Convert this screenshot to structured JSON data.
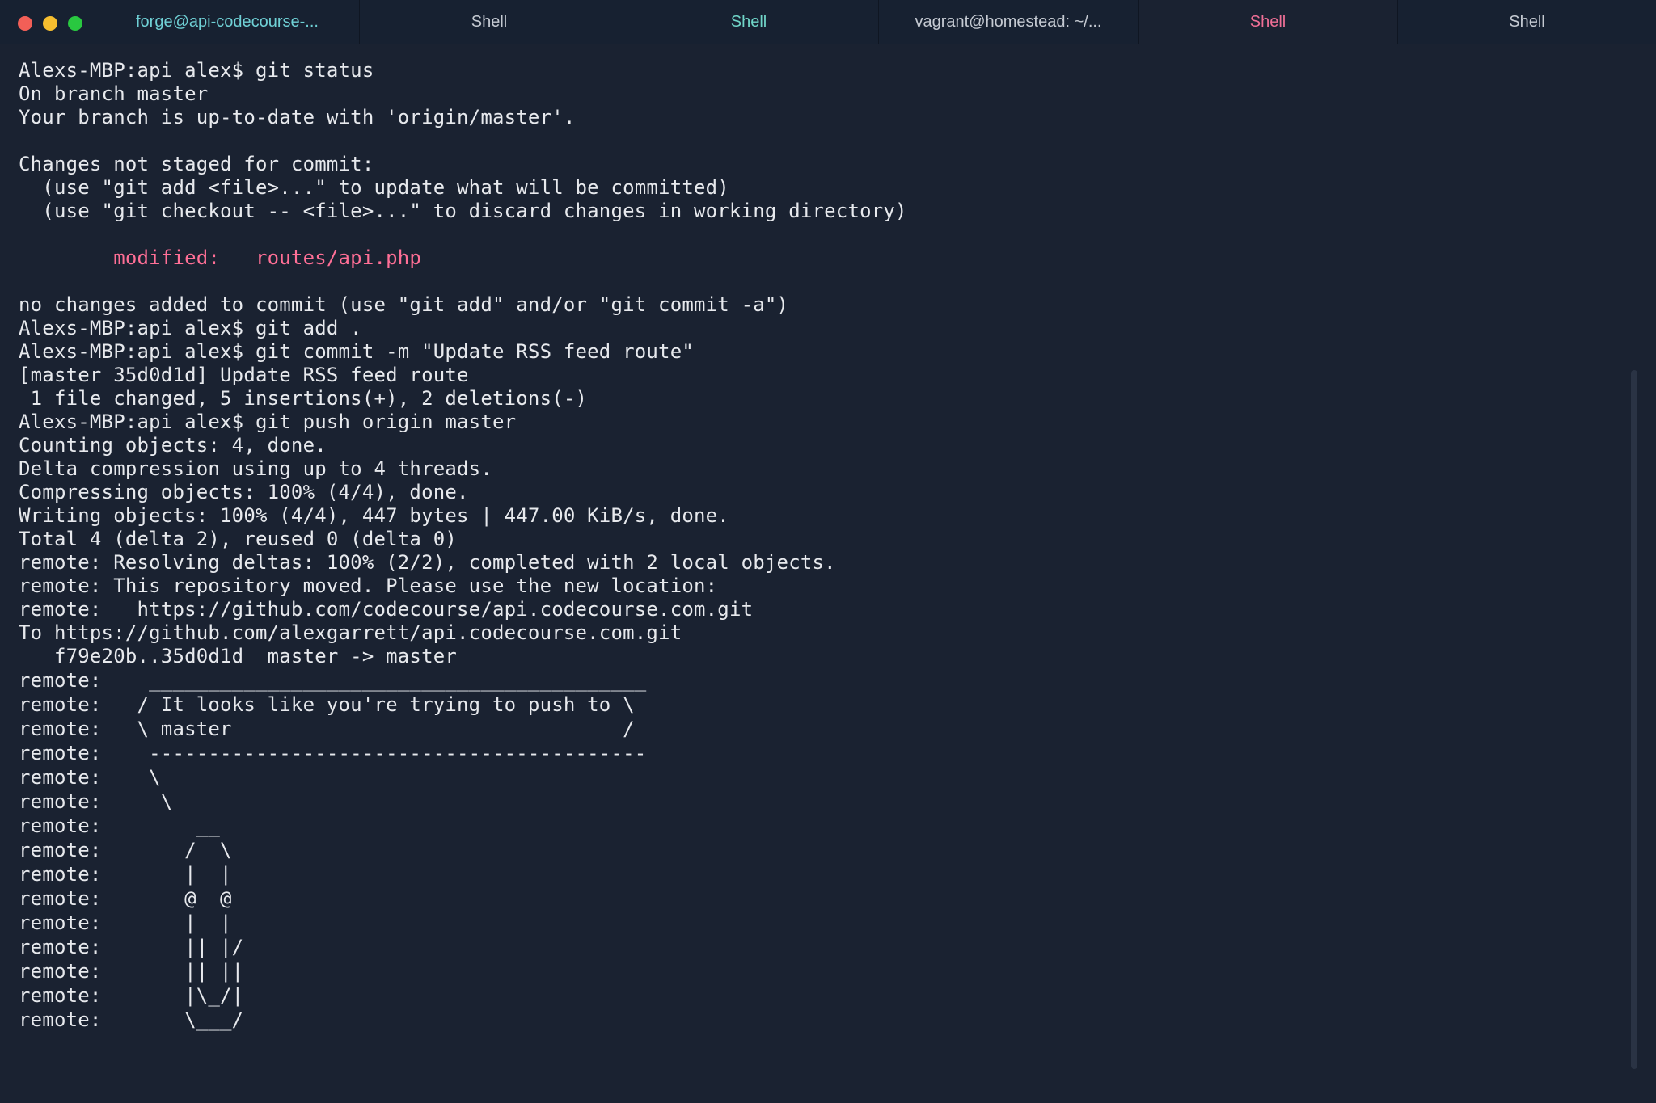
{
  "window": {
    "traffic_lights": [
      {
        "name": "close",
        "color": "#f25f57"
      },
      {
        "name": "minimize",
        "color": "#f6be2f"
      },
      {
        "name": "maximize",
        "color": "#29c840"
      }
    ]
  },
  "tabs": [
    {
      "title": "forge@api-codecourse-...",
      "color": "#6fd0d5"
    },
    {
      "title": "Shell",
      "color": "#c5cad2"
    },
    {
      "title": "Shell",
      "color": "#70d5c8"
    },
    {
      "title": "vagrant@homestead: ~/...",
      "color": "#c5cad2"
    },
    {
      "title": "Shell",
      "color": "#ef6f96",
      "active": true
    },
    {
      "title": "Shell",
      "color": "#c5cad2"
    }
  ],
  "terminal": {
    "default_color": "#e7e9ed",
    "accent_color": "#ff6f96",
    "lines": [
      {
        "text": "Alexs-MBP:api alex$ git status"
      },
      {
        "text": "On branch master"
      },
      {
        "text": "Your branch is up-to-date with 'origin/master'."
      },
      {
        "text": ""
      },
      {
        "text": "Changes not staged for commit:"
      },
      {
        "text": "  (use \"git add <file>...\" to update what will be committed)"
      },
      {
        "text": "  (use \"git checkout -- <file>...\" to discard changes in working directory)"
      },
      {
        "text": ""
      },
      {
        "text": "        modified:   routes/api.php",
        "color": "#ff6f96"
      },
      {
        "text": ""
      },
      {
        "text": "no changes added to commit (use \"git add\" and/or \"git commit -a\")"
      },
      {
        "text": "Alexs-MBP:api alex$ git add ."
      },
      {
        "text": "Alexs-MBP:api alex$ git commit -m \"Update RSS feed route\""
      },
      {
        "text": "[master 35d0d1d] Update RSS feed route"
      },
      {
        "text": " 1 file changed, 5 insertions(+), 2 deletions(-)"
      },
      {
        "text": "Alexs-MBP:api alex$ git push origin master"
      },
      {
        "text": "Counting objects: 4, done."
      },
      {
        "text": "Delta compression using up to 4 threads."
      },
      {
        "text": "Compressing objects: 100% (4/4), done."
      },
      {
        "text": "Writing objects: 100% (4/4), 447 bytes | 447.00 KiB/s, done."
      },
      {
        "text": "Total 4 (delta 2), reused 0 (delta 0)"
      },
      {
        "text": "remote: Resolving deltas: 100% (2/2), completed with 2 local objects."
      },
      {
        "text": "remote: This repository moved. Please use the new location:"
      },
      {
        "text": "remote:   https://github.com/codecourse/api.codecourse.com.git"
      },
      {
        "text": "To https://github.com/alexgarrett/api.codecourse.com.git"
      },
      {
        "text": "   f79e20b..35d0d1d  master -> master"
      },
      {
        "text": "remote:    __________________________________________",
        "ascii": true
      },
      {
        "text": "remote:   / It looks like you're trying to push to \\",
        "ascii": true
      },
      {
        "text": "remote:   \\ master                                 /",
        "ascii": true
      },
      {
        "text": "remote:    ------------------------------------------",
        "ascii": true
      },
      {
        "text": "remote:    \\",
        "ascii": true
      },
      {
        "text": "remote:     \\",
        "ascii": true
      },
      {
        "text": "remote:        __",
        "ascii": true
      },
      {
        "text": "remote:       /  \\",
        "ascii": true
      },
      {
        "text": "remote:       |  |",
        "ascii": true
      },
      {
        "text": "remote:       @  @",
        "ascii": true
      },
      {
        "text": "remote:       |  |",
        "ascii": true
      },
      {
        "text": "remote:       || |/",
        "ascii": true
      },
      {
        "text": "remote:       || ||",
        "ascii": true
      },
      {
        "text": "remote:       |\\_/|",
        "ascii": true
      },
      {
        "text": "remote:       \\___/",
        "ascii": true
      }
    ]
  }
}
